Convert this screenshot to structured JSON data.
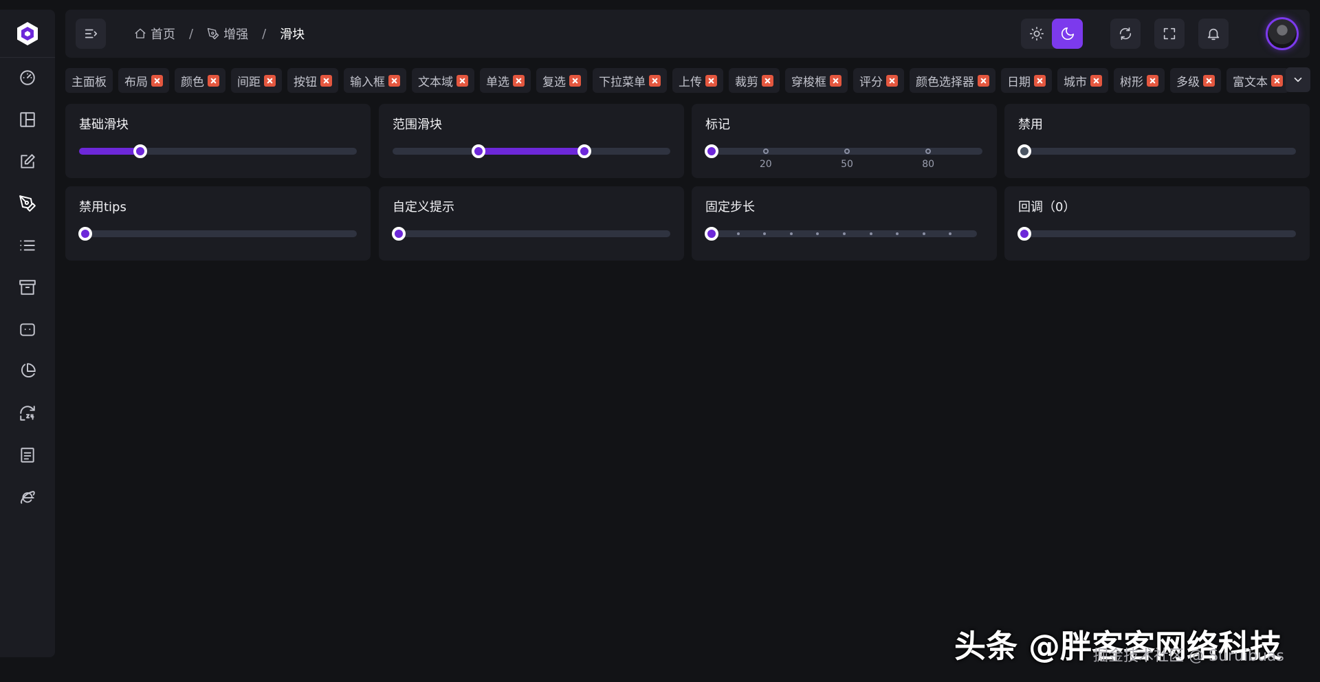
{
  "sidebar": {
    "logo_icon": "brand-logo-icon",
    "items": [
      {
        "name": "dashboard",
        "icon": "gauge-icon"
      },
      {
        "name": "layout",
        "icon": "layout-icon"
      },
      {
        "name": "form",
        "icon": "edit-icon"
      },
      {
        "name": "enhance",
        "icon": "pen-tool-icon"
      },
      {
        "name": "list",
        "icon": "list-icon"
      },
      {
        "name": "archive",
        "icon": "archive-icon"
      },
      {
        "name": "chat",
        "icon": "message-icon"
      },
      {
        "name": "chart",
        "icon": "pie-chart-icon"
      },
      {
        "name": "history",
        "icon": "history-24-icon"
      },
      {
        "name": "document",
        "icon": "document-icon"
      },
      {
        "name": "browser",
        "icon": "ie-icon"
      }
    ]
  },
  "header": {
    "breadcrumb": {
      "home": "首页",
      "parent": "增强",
      "current": "滑块",
      "separator": "/"
    },
    "theme_mode": "dark",
    "accent_color": "#7c3aed"
  },
  "tags": [
    "主面板",
    "布局",
    "颜色",
    "间距",
    "按钮",
    "输入框",
    "文本域",
    "单选",
    "复选",
    "下拉菜单",
    "上传",
    "裁剪",
    "穿梭框",
    "评分",
    "颜色选择器",
    "日期",
    "城市",
    "树形",
    "多级",
    "富文本"
  ],
  "cards": {
    "basic": {
      "title": "基础滑块",
      "value": 0.22
    },
    "range": {
      "title": "范围滑块",
      "value_start": 0.31,
      "value_end": 0.69
    },
    "marks": {
      "title": "标记",
      "value": 0,
      "mark_labels": [
        "20",
        "50",
        "80"
      ]
    },
    "disabled": {
      "title": "禁用",
      "value": 0
    },
    "disabled_tips": {
      "title": "禁用tips",
      "value": 0
    },
    "custom_tips": {
      "title": "自定义提示",
      "value": 0
    },
    "fixed_step": {
      "title": "固定步长",
      "value": 0,
      "steps": 10
    },
    "callback": {
      "title": "回调（0）",
      "value": 0
    }
  },
  "watermark": {
    "main": "头条 @胖客客网络科技",
    "sub": "掘金技术社区 @ Suruibuas"
  }
}
